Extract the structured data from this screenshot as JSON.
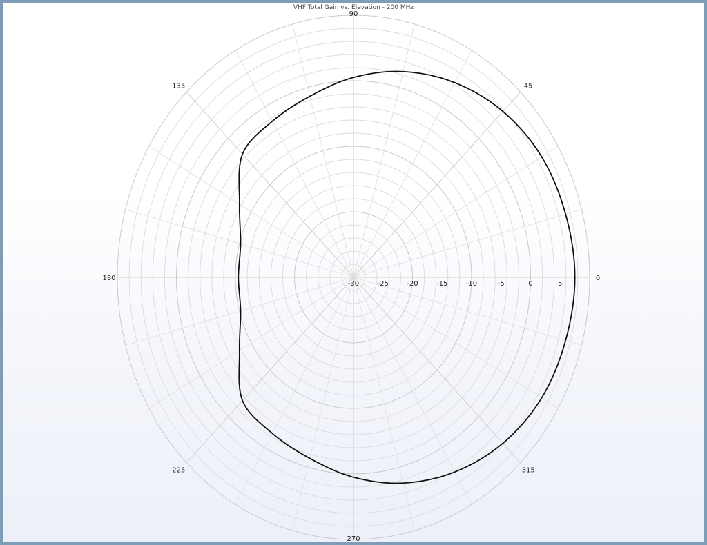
{
  "chart_data": {
    "type": "polar-line",
    "title": "VHF Total Gain vs. Elevation - 200 MHz",
    "angle_ticks": [
      "0",
      "45",
      "90",
      "135",
      "180",
      "225",
      "270",
      "315"
    ],
    "angle_tick_values": [
      0,
      45,
      90,
      135,
      180,
      225,
      270,
      315
    ],
    "radial_ticks": [
      "-30",
      "-25",
      "-20",
      "-15",
      "-10",
      "-5",
      "0",
      "5"
    ],
    "radial_tick_values": [
      -30,
      -25,
      -20,
      -15,
      -10,
      -5,
      0,
      5
    ],
    "rlim": [
      -30,
      10
    ],
    "grid": true,
    "series": [
      {
        "theta": [
          0,
          15,
          30,
          45,
          60,
          75,
          90,
          105,
          120,
          135,
          150,
          165,
          180,
          195,
          210,
          225,
          240,
          255,
          270,
          285,
          300,
          315,
          330,
          345,
          360
        ],
        "r": [
          7.5,
          7.2,
          6.8,
          5.8,
          4.3,
          2.5,
          0.5,
          -1.4,
          -2.5,
          -3.4,
          -7.7,
          -10.2,
          -10.5,
          -10.2,
          -7.7,
          -3.4,
          -2.5,
          -1.4,
          0.5,
          2.5,
          4.3,
          5.8,
          6.8,
          7.2,
          7.5
        ],
        "color": "#111111"
      }
    ]
  }
}
